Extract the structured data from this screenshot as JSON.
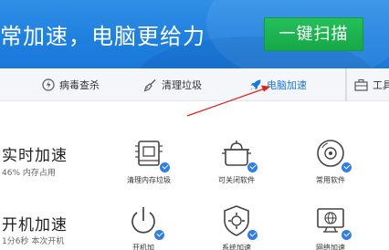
{
  "header": {
    "slogan": "常加速，电脑更给力",
    "scan_button": "一键扫描"
  },
  "nav": {
    "items": [
      {
        "label": "病毒查杀",
        "icon": "virus-scan-icon"
      },
      {
        "label": "清理垃圾",
        "icon": "broom-icon"
      },
      {
        "label": "电脑加速",
        "icon": "rocket-icon",
        "active": true
      },
      {
        "label": "工具",
        "icon": "toolbox-icon"
      }
    ]
  },
  "sections": {
    "realtime": {
      "title": "实时加速",
      "subtitle": "46% 内存占用"
    },
    "startup": {
      "title": "开机加速",
      "subtitle": "1分6秒 本次开机"
    }
  },
  "tiles": {
    "row1": [
      {
        "label": "清理内存垃圾",
        "icon": "memory-chip-icon"
      },
      {
        "label": "可关闭软件",
        "icon": "pot-icon"
      },
      {
        "label": "常用软件",
        "icon": "disc-icon"
      }
    ],
    "row2": [
      {
        "label": "开机加",
        "icon": "power-icon"
      },
      {
        "label": "系统加速",
        "icon": "gear-shield-icon"
      },
      {
        "label": "网络加速",
        "icon": "network-monitor-icon"
      }
    ]
  },
  "colors": {
    "header_blue": "#1f7fde",
    "scan_green": "#1ab24e",
    "active_blue": "#1a78d8",
    "badge_blue": "#2f7fe0",
    "arrow_red": "#e02020"
  }
}
